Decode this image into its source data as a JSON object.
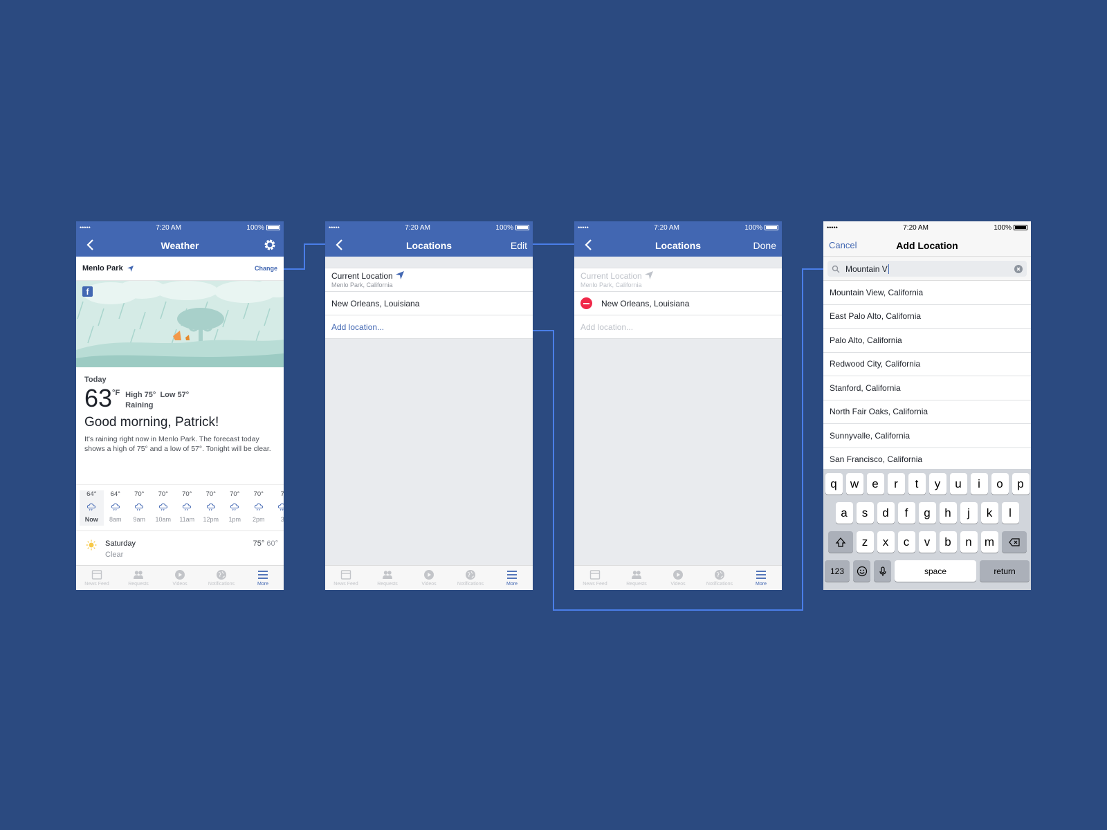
{
  "status": {
    "signal": "•••••",
    "time": "7:20 AM",
    "battery": "100%"
  },
  "tabbar": [
    {
      "label": "News Feed",
      "icon": "news-feed-icon",
      "active": false
    },
    {
      "label": "Requests",
      "icon": "requests-icon",
      "active": false
    },
    {
      "label": "Videos",
      "icon": "videos-icon",
      "active": false
    },
    {
      "label": "Notifications",
      "icon": "notifications-icon",
      "active": false
    },
    {
      "label": "More",
      "icon": "more-icon",
      "active": true
    }
  ],
  "weather": {
    "title": "Weather",
    "location": "Menlo Park",
    "change": "Change",
    "fb_logo": "f",
    "today_label": "Today",
    "temp": "63",
    "unit": "°F",
    "high": "High 75°",
    "low": "Low 57°",
    "condition": "Raining",
    "greeting": "Good morning, Patrick!",
    "summary": "It's raining right now in Menlo Park. The forecast today shows a high of 75° and a low of 57°. Tonight will be clear.",
    "hourly": [
      {
        "temp": "64°",
        "label": "Now"
      },
      {
        "temp": "64°",
        "label": "8am"
      },
      {
        "temp": "70°",
        "label": "9am"
      },
      {
        "temp": "70°",
        "label": "10am"
      },
      {
        "temp": "70°",
        "label": "11am"
      },
      {
        "temp": "70°",
        "label": "12pm"
      },
      {
        "temp": "70°",
        "label": "1pm"
      },
      {
        "temp": "70°",
        "label": "2pm"
      },
      {
        "temp": "7",
        "label": "3"
      }
    ],
    "daily": {
      "day": "Saturday",
      "condition": "Clear",
      "high": "75°",
      "low": "60°"
    }
  },
  "locations": {
    "title": "Locations",
    "edit": "Edit",
    "done": "Done",
    "current": "Current Location",
    "current_sub": "Menlo Park, California",
    "saved": "New Orleans, Louisiana",
    "add": "Add location..."
  },
  "add_location": {
    "cancel": "Cancel",
    "title": "Add Location",
    "query": "Mountain V",
    "suggestions": [
      "Mountain View, California",
      "East Palo Alto, California",
      "Palo Alto, California",
      "Redwood City, California",
      "Stanford, California",
      "North Fair Oaks, California",
      "Sunnyvalle, California",
      "San Francisco, California"
    ],
    "keyboard": {
      "row1": [
        "q",
        "w",
        "e",
        "r",
        "t",
        "y",
        "u",
        "i",
        "o",
        "p"
      ],
      "row2": [
        "a",
        "s",
        "d",
        "f",
        "g",
        "h",
        "j",
        "k",
        "l"
      ],
      "row3": [
        "z",
        "x",
        "c",
        "v",
        "b",
        "n",
        "m"
      ],
      "numbers": "123",
      "space": "space",
      "return": "return"
    }
  },
  "colors": {
    "background": "#2b4a80",
    "fb_blue": "#4267b2",
    "connector": "#4a7ee8",
    "delete_red": "#f02849"
  }
}
